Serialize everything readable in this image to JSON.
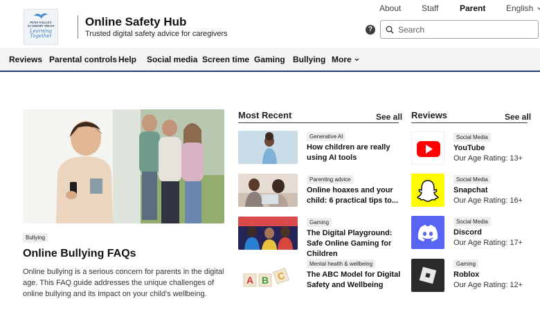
{
  "header": {
    "logo": {
      "school": "PENN VALLEY ACADEMY TRUST",
      "script": "Learning Together"
    },
    "title": "Online Safety Hub",
    "tagline": "Trusted digital safety advice for caregivers",
    "top_links": [
      "About",
      "Staff",
      "Parent",
      "English"
    ],
    "search_placeholder": "Search"
  },
  "nav": {
    "items": [
      "Reviews",
      "Parental controls",
      "Help",
      "Social media",
      "Screen time",
      "Gaming",
      "Bullying",
      "More"
    ]
  },
  "featured": {
    "badge": "Bullying",
    "title": "Online Bullying FAQs",
    "description": "Online bullying is a serious concern for parents in the digital age. This FAQ guide addresses the unique challenges of online bullying and its impact on your child's wellbeing."
  },
  "most_recent": {
    "heading": "Most Recent",
    "see_all": "See all",
    "items": [
      {
        "badge": "Generative AI",
        "title": "How children are really using AI tools"
      },
      {
        "badge": "Parenting advice",
        "title": "Online hoaxes and your child: 6 practical tips to..."
      },
      {
        "badge": "Gaming",
        "title": "The Digital Playground: Safe Online Gaming for Children"
      },
      {
        "badge": "Mental health & wellbeing",
        "title": "The ABC Model for Digital Safety and Wellbeing"
      }
    ]
  },
  "reviews": {
    "heading": "Reviews",
    "see_all": "See all",
    "items": [
      {
        "badge": "Social Media",
        "name": "YouTube",
        "rating": "Our Age Rating: 13+"
      },
      {
        "badge": "Social Media",
        "name": "Snapchat",
        "rating": "Our Age Rating: 16+"
      },
      {
        "badge": "Social Media",
        "name": "Discord",
        "rating": "Our Age Rating: 17+"
      },
      {
        "badge": "Gaming",
        "name": "Roblox",
        "rating": "Our Age Rating: 12+"
      }
    ]
  },
  "colors": {
    "nav_border": "#1f3f73",
    "youtube": "#ff0000",
    "snapchat": "#fffc00",
    "discord": "#5865f2",
    "roblox": "#2b2b2b"
  }
}
